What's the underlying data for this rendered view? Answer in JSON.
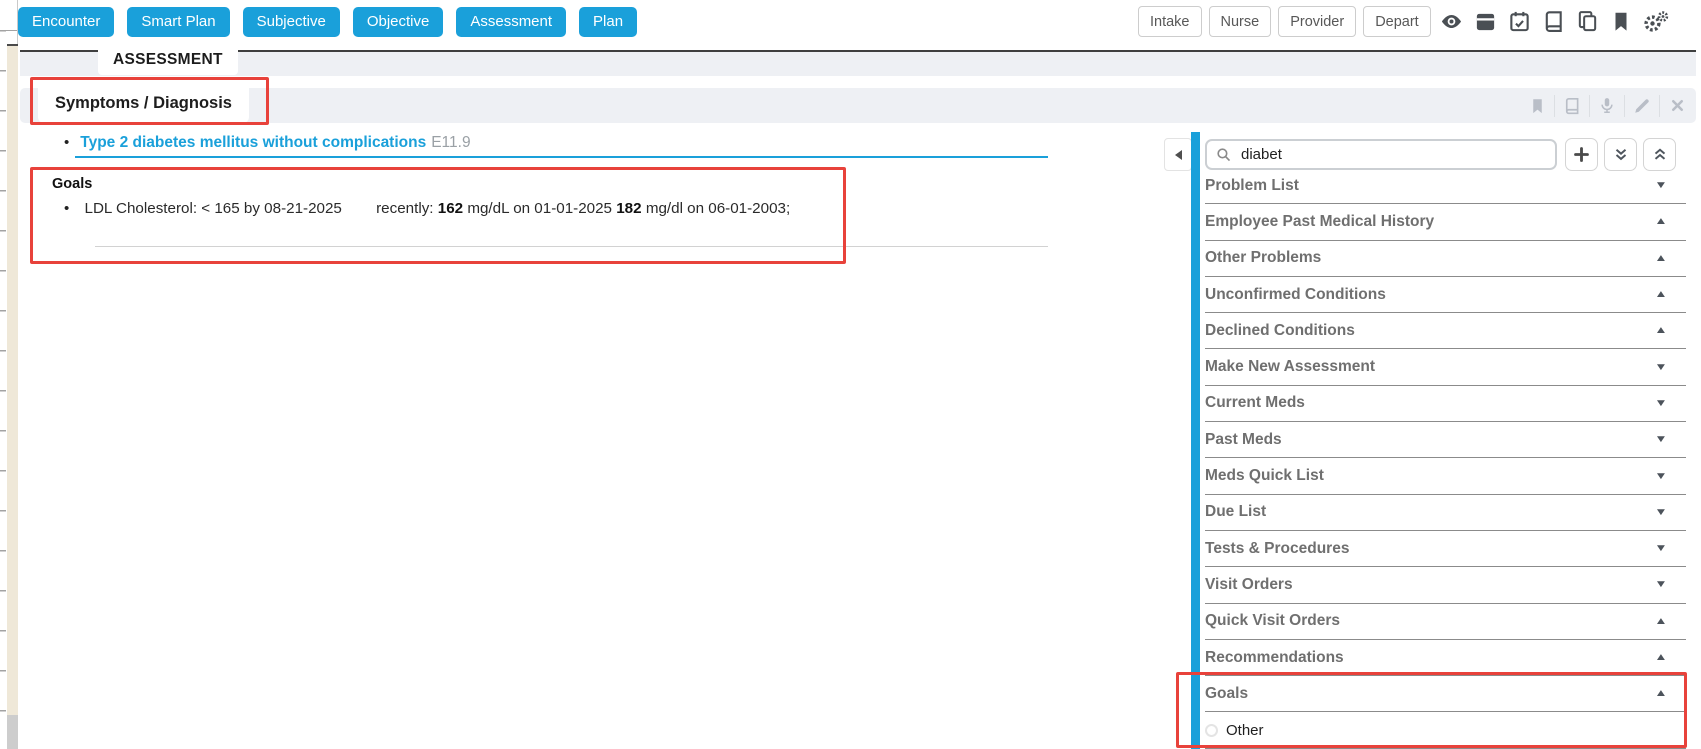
{
  "toolbar": {
    "nav_buttons": [
      "Encounter",
      "Smart Plan",
      "Subjective",
      "Objective",
      "Assessment",
      "Plan"
    ],
    "stage_buttons": [
      "Intake",
      "Nurse",
      "Provider",
      "Depart"
    ],
    "icon_buttons": [
      "eye-icon",
      "archive-icon",
      "calendar-check-icon",
      "book-icon",
      "copy-icon",
      "bookmark-icon",
      "settings-gears-icon"
    ]
  },
  "page": {
    "title": "ASSESSMENT"
  },
  "section": {
    "title": "Symptoms / Diagnosis",
    "icons": [
      "bookmark-icon",
      "book-icon",
      "microphone-icon",
      "pencil-icon",
      "close-icon"
    ]
  },
  "diagnosis": {
    "name": "Type 2 diabetes mellitus without complications",
    "code": "E11.9"
  },
  "goals": {
    "heading": "Goals",
    "item": {
      "target": "LDL Cholesterol: < 165 by 08-21-2025",
      "recently_label": "recently:",
      "value1": "162",
      "detail1": "mg/dL on 01-01-2025",
      "value2": "182",
      "detail2": "mg/dl on 06-01-2003;"
    }
  },
  "sidebar": {
    "search": {
      "value": "diabet"
    },
    "action_buttons": [
      "add",
      "expand-all",
      "collapse-all"
    ],
    "items": [
      {
        "label": "Problem List",
        "chevron": "down"
      },
      {
        "label": "Employee Past Medical History",
        "chevron": "up"
      },
      {
        "label": "Other Problems",
        "chevron": "up"
      },
      {
        "label": "Unconfirmed Conditions",
        "chevron": "up"
      },
      {
        "label": "Declined Conditions",
        "chevron": "up"
      },
      {
        "label": "Make New Assessment",
        "chevron": "down"
      },
      {
        "label": "Current Meds",
        "chevron": "down"
      },
      {
        "label": "Past Meds",
        "chevron": "down"
      },
      {
        "label": "Meds Quick List",
        "chevron": "down"
      },
      {
        "label": "Due List",
        "chevron": "down"
      },
      {
        "label": "Tests & Procedures",
        "chevron": "down"
      },
      {
        "label": "Visit Orders",
        "chevron": "down"
      },
      {
        "label": "Quick Visit Orders",
        "chevron": "up"
      },
      {
        "label": "Recommendations",
        "chevron": "up"
      },
      {
        "label": "Goals",
        "chevron": "up"
      },
      {
        "label": "Other",
        "type": "radio"
      }
    ]
  },
  "colors": {
    "accent": "#1aa0da",
    "annotation": "#e8423b"
  }
}
